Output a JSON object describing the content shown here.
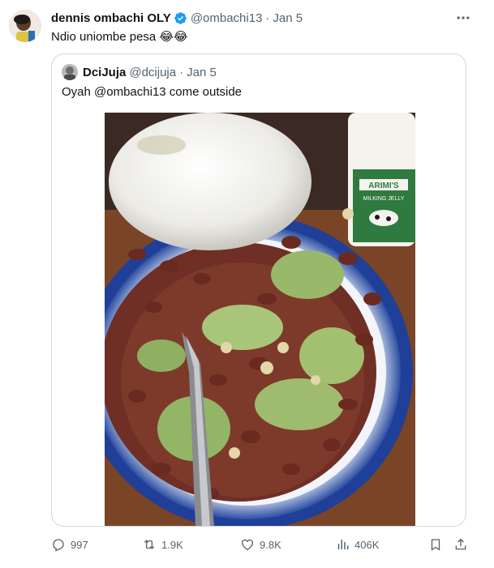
{
  "tweet": {
    "author_name": "dennis ombachi OLY",
    "author_handle": "@ombachi13",
    "separator": "·",
    "date": "Jan 5",
    "text": "Ndio uniombe pesa 😂😂"
  },
  "quoted": {
    "author_name": "DciJuja",
    "author_handle": "@dcijuja",
    "separator": "·",
    "date": "Jan 5",
    "text": "Oyah @ombachi13 come outside",
    "image_label": {
      "brand": "ARIMI'S",
      "product": "MILKING JELLY"
    }
  },
  "actions": {
    "replies": "997",
    "retweets": "1.9K",
    "likes": "9.8K",
    "views": "406K"
  },
  "colors": {
    "verified": "#1d9bf0",
    "secondary_text": "#536471",
    "border": "#cfd9de"
  },
  "icons": [
    "verified-badge-icon",
    "more-options-icon",
    "reply-icon",
    "retweet-icon",
    "like-icon",
    "views-icon",
    "bookmark-icon",
    "share-icon"
  ]
}
